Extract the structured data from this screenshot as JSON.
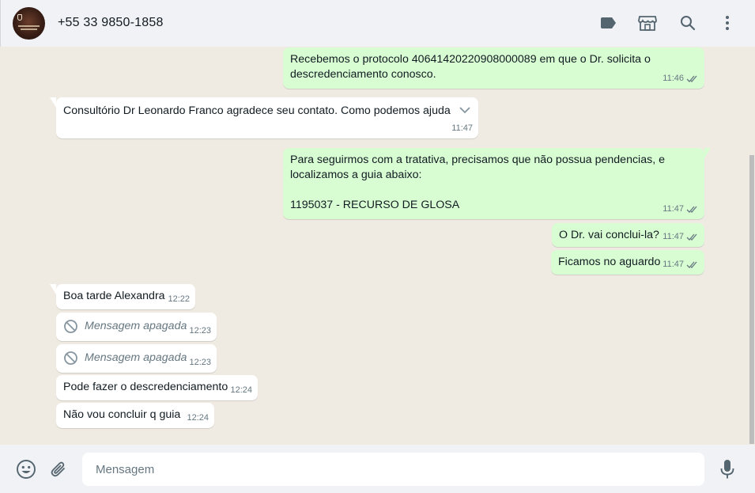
{
  "header": {
    "contact_name": "+55 33 9850-1858",
    "icons": [
      "label-icon",
      "catalog-icon",
      "search-icon",
      "menu-icon"
    ]
  },
  "messages": [
    {
      "dir": "out",
      "text": "Recebemos o protocolo 40641420220908000089 em que o Dr. solicita o\ndescredenciamento conosco.",
      "time": "11:46",
      "status": "read"
    },
    {
      "dir": "in",
      "text": "Consultório Dr Leonardo Franco agradece seu contato. Como podemos ajuda",
      "time": "11:47"
    },
    {
      "dir": "out",
      "text": "Para seguirmos com a tratativa, precisamos que não possua pendencias, e\nlocalizamos a guia abaixo:\n\n1195037 - RECURSO DE GLOSA",
      "time": "11:47",
      "status": "read"
    },
    {
      "dir": "out",
      "text": "O Dr. vai conclui-la?",
      "time": "11:47",
      "status": "read"
    },
    {
      "dir": "out",
      "text": "Ficamos no aguardo",
      "time": "11:47",
      "status": "read"
    },
    {
      "dir": "in",
      "text": "Boa tarde Alexandra",
      "time": "12:22"
    },
    {
      "dir": "in",
      "text": "Mensagem apagada",
      "time": "12:23",
      "deleted": true
    },
    {
      "dir": "in",
      "text": "Mensagem apagada",
      "time": "12:23",
      "deleted": true
    },
    {
      "dir": "in",
      "text": "Pode fazer o descredenciamento",
      "time": "12:24"
    },
    {
      "dir": "in",
      "text": "Não vou concluir q guia",
      "time": "12:24"
    }
  ],
  "footer": {
    "placeholder": "Mensagem",
    "value": ""
  },
  "colors": {
    "outgoing_bubble": "#d9fdd3",
    "incoming_bubble": "#ffffff",
    "chat_background": "#efeae2",
    "read_tick": "#667781"
  }
}
